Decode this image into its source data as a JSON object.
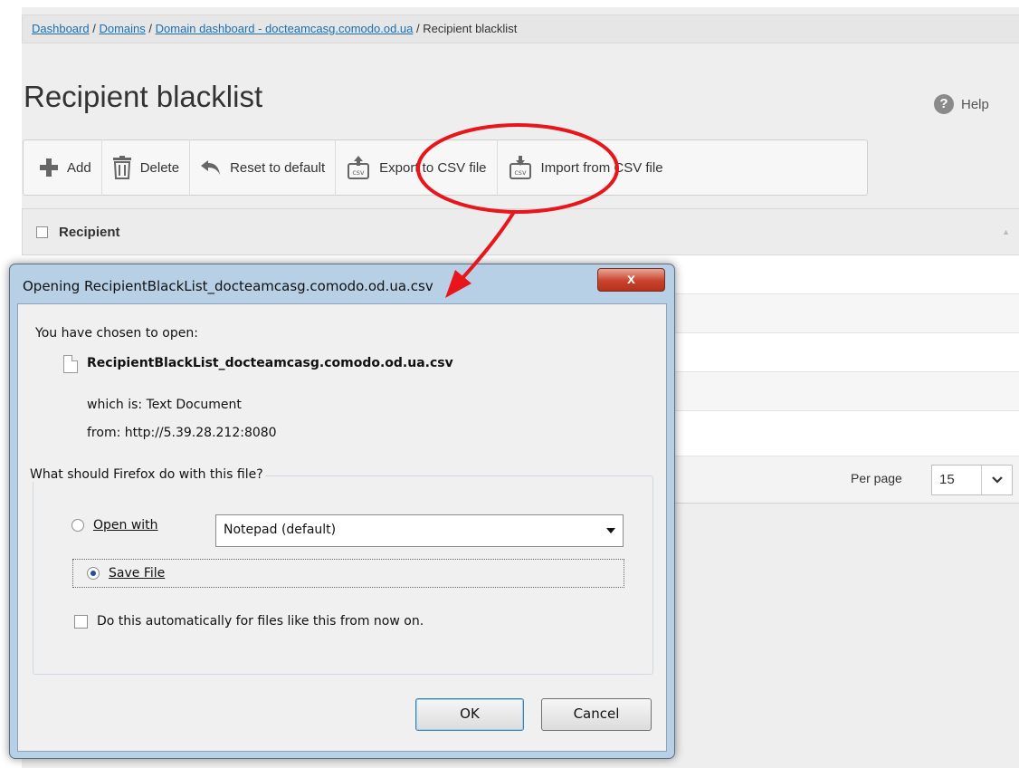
{
  "breadcrumb": {
    "items": [
      "Dashboard",
      "Domains",
      "Domain dashboard - docteamcasg.comodo.od.ua"
    ],
    "separator": "/",
    "current": "Recipient blacklist"
  },
  "page": {
    "title": "Recipient blacklist",
    "help_label": "Help"
  },
  "toolbar": {
    "add_label": "Add",
    "delete_label": "Delete",
    "reset_label": "Reset to default",
    "export_label": "Export to CSV file",
    "import_label": "Import from CSV file"
  },
  "grid": {
    "column_header": "Recipient",
    "per_page_label": "Per page",
    "per_page_value": "15"
  },
  "dialog": {
    "title": "Opening RecipientBlackList_docteamcasg.comodo.od.ua.csv",
    "close_glyph": "x",
    "chosen_text": "You have chosen to open:",
    "file_name": "RecipientBlackList_docteamcasg.comodo.od.ua.csv",
    "which_label": "which is:",
    "which_value": "Text Document",
    "from_label": "from:",
    "from_value": "http://5.39.28.212:8080",
    "question": "What should Firefox do with this file?",
    "open_with_label": "Open with",
    "open_with_value": "Notepad (default)",
    "save_file_label": "Save File",
    "save_file_selected": true,
    "auto_label": "Do this automatically for files like this from now on.",
    "ok_label": "OK",
    "cancel_label": "Cancel"
  },
  "colors": {
    "link": "#1a6fb5",
    "annotation": "#e8151b",
    "dialog_frame": "#b8d0e6",
    "close_button": "#c8432c"
  }
}
